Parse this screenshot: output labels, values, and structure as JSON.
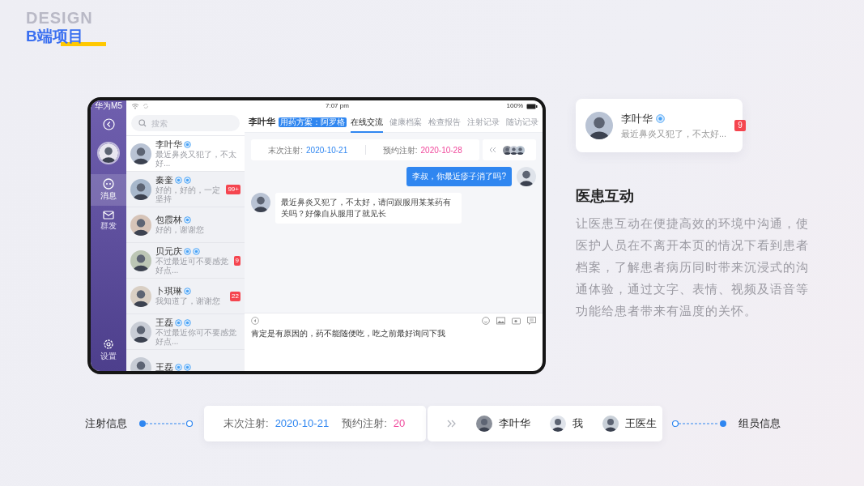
{
  "header": {
    "backdrop_text": "DESIGN",
    "title": "B端项目"
  },
  "tablet": {
    "status_bar": {
      "carrier": "华为M5",
      "time": "7:07 pm",
      "battery": "100%"
    },
    "nav": [
      {
        "kind": "messages",
        "label": "消息",
        "selected": true
      },
      {
        "kind": "broadcast",
        "label": "群发",
        "selected": false
      },
      {
        "kind": "settings",
        "label": "设置",
        "selected": false
      }
    ],
    "search": {
      "placeholder": "搜索"
    },
    "contacts": [
      {
        "name": "李叶华",
        "tags": [
          {
            "kind": "verified"
          }
        ],
        "preview": "最近鼻炎又犯了，不太好...",
        "selected": true
      },
      {
        "name": "秦奎",
        "tags": [
          {
            "kind": "verified"
          },
          {
            "kind": "verified"
          }
        ],
        "preview": "好的，好的，一定坚持",
        "unread": "99+",
        "selected": false
      },
      {
        "name": "包霞林",
        "tags": [
          {
            "kind": "verified"
          }
        ],
        "preview": "好的，谢谢您",
        "selected": false
      },
      {
        "name": "贝元庆",
        "tags": [
          {
            "kind": "verified"
          },
          {
            "kind": "verified"
          }
        ],
        "preview": "不过最近可不要感觉好点...",
        "unread": "9",
        "selected": false
      },
      {
        "name": "卜琪琳",
        "tags": [
          {
            "kind": "verified"
          }
        ],
        "preview": "我知道了，谢谢您",
        "unread": "22",
        "selected": false
      },
      {
        "name": "王磊",
        "tags": [
          {
            "kind": "verified"
          },
          {
            "kind": "verified"
          }
        ],
        "preview": "不过最近你可不要感觉好点...",
        "selected": false
      },
      {
        "name": "王磊",
        "tags": [
          {
            "kind": "verified"
          },
          {
            "kind": "verified"
          }
        ],
        "selected": false
      }
    ],
    "chat": {
      "patient": "李叶华",
      "plan_tag": "用药方案：阿罗格",
      "tabs": [
        {
          "label": "在线交流",
          "selected": true
        },
        {
          "label": "健康档案",
          "selected": false
        },
        {
          "label": "检查报告",
          "selected": false
        },
        {
          "label": "注射记录",
          "selected": false
        },
        {
          "label": "随访记录",
          "selected": false
        }
      ],
      "injection": {
        "last_label": "末次注射:",
        "last_date": "2020-10-21",
        "next_label": "预约注射:",
        "next_date": "2020-10-28"
      },
      "messages": [
        {
          "kind": "outgoing",
          "text": "李叔，你最近疹子消了吗?"
        },
        {
          "kind": "incoming",
          "text": "最近鼻炎又犯了，不太好，请问跟服用某某药有关吗？好像自从服用了就见长"
        }
      ],
      "draft": "肯定是有原因的，药不能随便吃，吃之前最好询问下我"
    }
  },
  "notification": {
    "name": "李叶华",
    "tags": [
      {
        "kind": "verified"
      }
    ],
    "preview": "最近鼻炎又犯了，不太好...",
    "unread": "9"
  },
  "feature": {
    "title": "医患互动",
    "description": "让医患互动在便捷高效的环境中沟通，使医护人员在不离开本页的情况下看到患者档案，了解患者病历同时带来沉浸式的沟通体验，通过文字、表情、视频及语音等功能给患者带来有温度的关怀。"
  },
  "strip": {
    "left_label": "注射信息",
    "last_label": "末次注射:",
    "last_date": "2020-10-21",
    "next_label": "预约注射:",
    "next_date": "20",
    "members": [
      {
        "name": "李叶华"
      },
      {
        "name": "我"
      },
      {
        "name": "王医生"
      }
    ],
    "right_label": "组员信息"
  }
}
